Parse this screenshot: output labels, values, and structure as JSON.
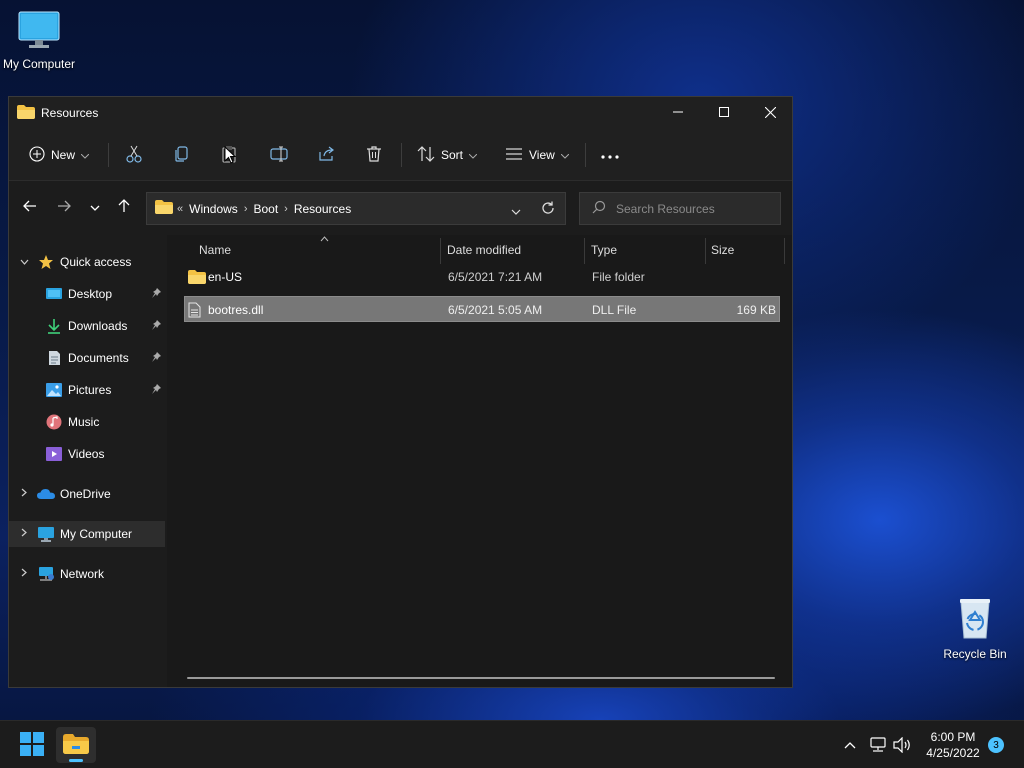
{
  "desktop": {
    "my_computer_label": "My Computer",
    "recycle_bin_label": "Recycle Bin"
  },
  "window": {
    "title": "Resources"
  },
  "toolbar": {
    "new_label": "New",
    "sort_label": "Sort",
    "view_label": "View"
  },
  "address": {
    "crumbs": [
      "Windows",
      "Boot",
      "Resources"
    ]
  },
  "search": {
    "placeholder": "Search Resources"
  },
  "sidebar": {
    "quick_access": "Quick access",
    "items": [
      {
        "label": "Desktop"
      },
      {
        "label": "Downloads"
      },
      {
        "label": "Documents"
      },
      {
        "label": "Pictures"
      },
      {
        "label": "Music"
      },
      {
        "label": "Videos"
      }
    ],
    "onedrive": "OneDrive",
    "my_computer": "My Computer",
    "network": "Network"
  },
  "files": {
    "columns": [
      "Name",
      "Date modified",
      "Type",
      "Size"
    ],
    "rows": [
      {
        "name": "en-US",
        "date": "6/5/2021 7:21 AM",
        "type": "File folder",
        "size": ""
      },
      {
        "name": "bootres.dll",
        "date": "6/5/2021 5:05 AM",
        "type": "DLL File",
        "size": "169 KB"
      }
    ]
  },
  "taskbar": {
    "time": "6:00 PM",
    "date": "4/25/2022",
    "notification_count": "3"
  },
  "colors": {
    "accent": "#4cc2ff",
    "folder": "#f3c244"
  }
}
